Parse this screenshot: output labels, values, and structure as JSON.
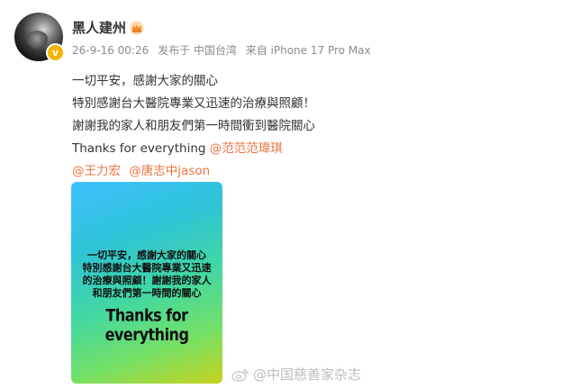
{
  "user": {
    "name": "黑人建州"
  },
  "meta": {
    "time": "26-9-16 00:26",
    "location": "发布于 中国台湾",
    "source": "来自 iPhone 17 Pro Max"
  },
  "post": {
    "lines": [
      "一切平安，感謝大家的關心",
      "特別感謝台大醫院專業又迅速的治療與照顧！",
      "謝謝我的家人和朋友們第一時間衝到醫院關心",
      "Thanks for everything"
    ],
    "mentions": [
      "@范范范瑋琪",
      "@王力宏",
      "@唐志中jason"
    ]
  },
  "image": {
    "lines": [
      "一切平安，感謝大家的關心",
      "特別感謝台大醫院專業又迅速",
      "的治療與照顧！謝謝我的家人",
      "和朋友們第一時間的關心"
    ],
    "thanks": "Thanks for everything"
  },
  "watermark": {
    "text": "@中国慈善家杂志"
  },
  "colors": {
    "mention": "#eb7340",
    "meta": "#8c8c8c",
    "badge": "#f5b400"
  }
}
